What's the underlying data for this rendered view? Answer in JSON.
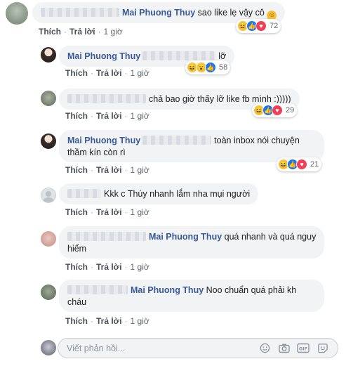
{
  "comments": [
    {
      "avatar": "avatar-grey-green",
      "name_redacted": true,
      "name": "",
      "tag": "Mai Phuong Thuy",
      "text": "sao like lẹ vậy cô",
      "emoji": "☺",
      "actions": [
        "Thích",
        "Trả lời",
        "1 giờ"
      ],
      "reactions": [
        "haha",
        "like",
        "love"
      ],
      "count": "72"
    },
    {
      "name": "Mai Phuong Thuy",
      "text": "lỡ",
      "actions": [
        "Thích",
        "Trả lời",
        "1 giờ"
      ],
      "reactions": [
        "haha",
        "wow",
        "like"
      ],
      "count": "58"
    },
    {
      "text": "chả bao giờ thấy lỡ like fb mình :)))))",
      "actions": [
        "Thích",
        "Trả lời",
        "1 giờ"
      ],
      "reactions": [
        "haha",
        "like",
        "love"
      ],
      "count": "29"
    },
    {
      "name": "Mai Phuong Thuy",
      "text_line1": "toàn inbox nói chuyện",
      "text_line2": "thầm kín còn rì",
      "actions": [
        "Thích",
        "Trả lời",
        "1 giờ"
      ],
      "reactions": [
        "haha",
        "like",
        "love"
      ],
      "count": "21"
    },
    {
      "text": "Kkk c Thúy nhanh lắm nha mụi người",
      "actions": [
        "Thích",
        "Trả lời",
        "1 giờ"
      ]
    },
    {
      "tag": "Mai Phuong Thuy",
      "text": "quá nhanh và quá nguy",
      "text_line2": "hiểm",
      "actions": [
        "Thích",
        "Trả lời",
        "1 giờ"
      ]
    },
    {
      "tag": "Mai Phuong Thuy",
      "text": "Noo chuẩn quá phải kh",
      "text_line2": "cháu",
      "actions": [
        "Thích",
        "Trả lời",
        "1 giờ"
      ]
    }
  ],
  "reply": {
    "placeholder": "Viết phản hồi...",
    "tools": [
      "emoji-icon",
      "camera-icon",
      "gif-icon",
      "sticker-icon"
    ]
  }
}
